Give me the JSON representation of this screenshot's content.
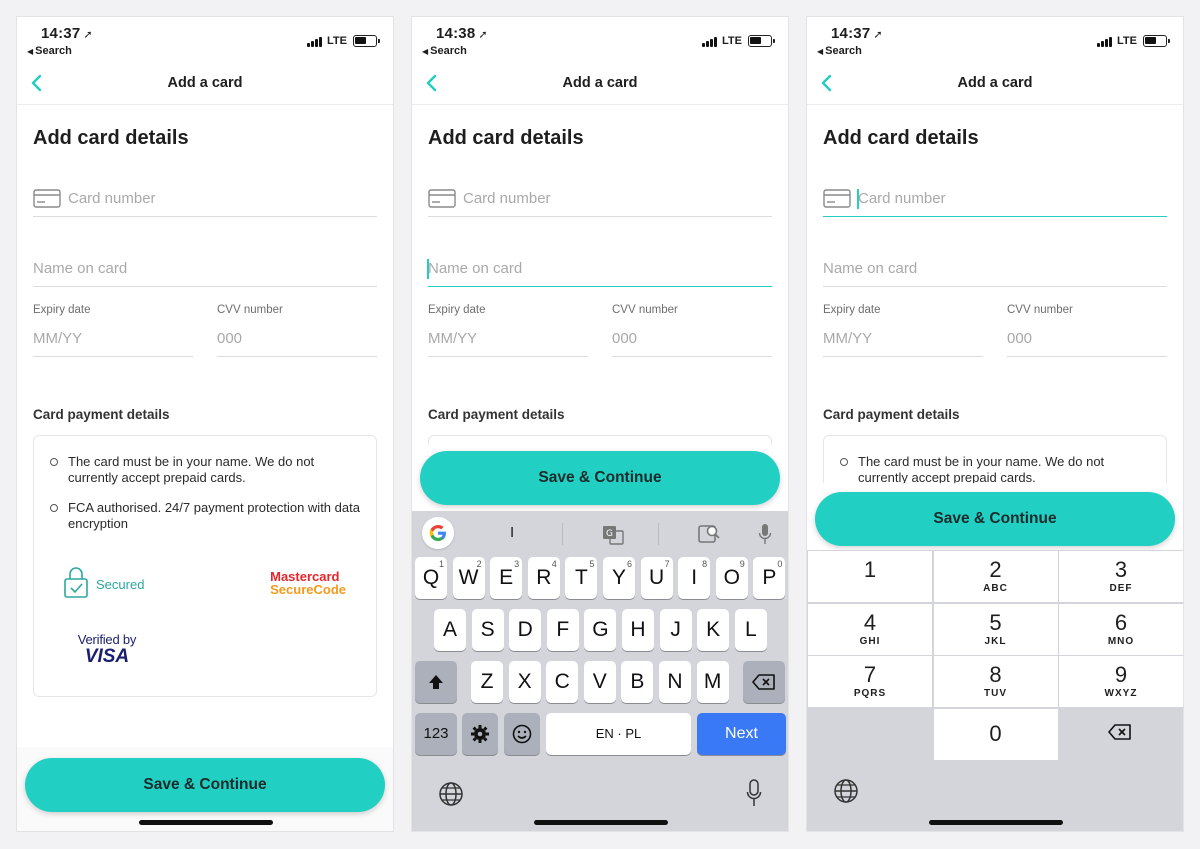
{
  "screens": [
    {
      "time": "14:37",
      "back_app": "Search",
      "carrier": "LTE",
      "title": "Add a card",
      "active_field": "none"
    },
    {
      "time": "14:38",
      "back_app": "Search",
      "carrier": "LTE",
      "title": "Add a card",
      "active_field": "name"
    },
    {
      "time": "14:37",
      "back_app": "Search",
      "carrier": "LTE",
      "title": "Add a card",
      "active_field": "card_number"
    }
  ],
  "form": {
    "heading": "Add card details",
    "card_number_placeholder": "Card number",
    "name_placeholder": "Name on card",
    "expiry_label": "Expiry date",
    "expiry_placeholder": "MM/YY",
    "cvv_label": "CVV number",
    "cvv_placeholder": "000",
    "section_label": "Card payment details"
  },
  "info": {
    "line1": "The card must be in your name. We do not currently accept prepaid cards.",
    "line2": "FCA authorised. 24/7 payment protection with data encryption",
    "secured": "Secured",
    "mastercard_l1": "Mastercard",
    "mastercard_l2": "SecureCode",
    "visa_l1": "Verified by",
    "visa_l2": "VISA"
  },
  "cta": "Save & Continue",
  "keyboard": {
    "suggestion": "I",
    "row1": [
      "Q",
      "W",
      "E",
      "R",
      "T",
      "Y",
      "U",
      "I",
      "O",
      "P"
    ],
    "row1_hints": [
      "1",
      "2",
      "3",
      "4",
      "5",
      "6",
      "7",
      "8",
      "9",
      "0"
    ],
    "row2": [
      "A",
      "S",
      "D",
      "F",
      "G",
      "H",
      "J",
      "K",
      "L"
    ],
    "row3": [
      "Z",
      "X",
      "C",
      "V",
      "B",
      "N",
      "M"
    ],
    "numbers_key": "123",
    "space_label": "EN · PL",
    "return_label": "Next"
  },
  "numpad": [
    {
      "digit": "1",
      "letters": ""
    },
    {
      "digit": "2",
      "letters": "ABC"
    },
    {
      "digit": "3",
      "letters": "DEF"
    },
    {
      "digit": "4",
      "letters": "GHI"
    },
    {
      "digit": "5",
      "letters": "JKL"
    },
    {
      "digit": "6",
      "letters": "MNO"
    },
    {
      "digit": "7",
      "letters": "PQRS"
    },
    {
      "digit": "8",
      "letters": "TUV"
    },
    {
      "digit": "9",
      "letters": "WXYZ"
    },
    {
      "digit": "0",
      "letters": ""
    }
  ],
  "colors": {
    "accent": "#21d0c3",
    "next_key": "#3a79f5",
    "keyboard_bg": "#d3d5db"
  }
}
